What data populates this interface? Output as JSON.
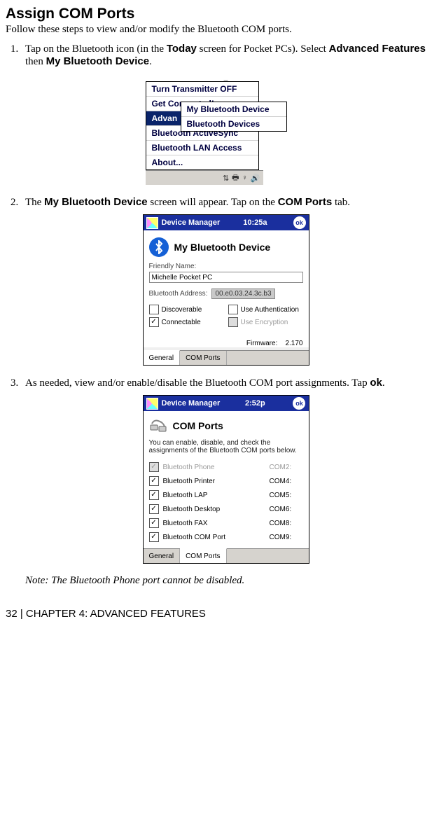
{
  "heading": "Assign COM Ports",
  "intro": "Follow these steps to view and/or modify the Bluetooth COM ports.",
  "steps": [
    {
      "pre": "Tap on the Bluetooth icon (in the ",
      "b1": "Today",
      "mid1": " screen for Pocket PCs). Select ",
      "b2": "Advanced Features",
      "mid2": " then ",
      "b3": "My Bluetooth Device",
      "post": "."
    },
    {
      "pre": "The ",
      "b1": "My Bluetooth Device",
      "mid1": " screen will appear. Tap on the ",
      "b2": "COM Ports",
      "post": " tab."
    },
    {
      "pre": "As needed, view and/or enable/disable the Bluetooth COM port assignments. Tap ",
      "b1": "ok",
      "post": "."
    }
  ],
  "fig1": {
    "menu": [
      "Turn Transmitter OFF",
      "Get Connected!",
      "Advanced Features",
      "Bluetooth ActiveSync",
      "Bluetooth LAN Access",
      "About..."
    ],
    "selected_prefix": "Advan",
    "submenu": [
      "My Bluetooth Device",
      "Bluetooth Devices"
    ],
    "tray": [
      "⇅",
      "🖶",
      "♀",
      "🔊"
    ]
  },
  "fig2": {
    "title": "Device Manager",
    "time": "10:25a",
    "ok": "ok",
    "header": "My Bluetooth Device",
    "friendly_label": "Friendly Name:",
    "friendly_value": "Michelle Pocket PC",
    "addr_label": "Bluetooth Address:",
    "addr_value": "00.e0.03.24.3c.b3",
    "checks": {
      "discoverable": "Discoverable",
      "use_auth": "Use Authentication",
      "connectable": "Connectable",
      "use_enc": "Use Encryption"
    },
    "firmware_label": "Firmware:",
    "firmware_value": "2.170",
    "tabs": {
      "general": "General",
      "com": "COM Ports"
    }
  },
  "fig3": {
    "title": "Device Manager",
    "time": "2:52p",
    "ok": "ok",
    "header": "COM Ports",
    "desc": "You can enable, disable, and check the assignments of the Bluetooth COM ports below.",
    "rows": [
      {
        "label": "Bluetooth Phone",
        "port": "COM2:",
        "checked": true,
        "disabled": true
      },
      {
        "label": "Bluetooth Printer",
        "port": "COM4:",
        "checked": true,
        "disabled": false
      },
      {
        "label": "Bluetooth LAP",
        "port": "COM5:",
        "checked": true,
        "disabled": false
      },
      {
        "label": "Bluetooth Desktop",
        "port": "COM6:",
        "checked": true,
        "disabled": false
      },
      {
        "label": "Bluetooth FAX",
        "port": "COM8:",
        "checked": true,
        "disabled": false
      },
      {
        "label": "Bluetooth COM Port",
        "port": "COM9:",
        "checked": true,
        "disabled": false
      }
    ],
    "tabs": {
      "general": "General",
      "com": "COM Ports"
    }
  },
  "note": "Note: The Bluetooth Phone port cannot be disabled.",
  "footer": "32 | CHAPTER 4: ADVANCED FEATURES"
}
